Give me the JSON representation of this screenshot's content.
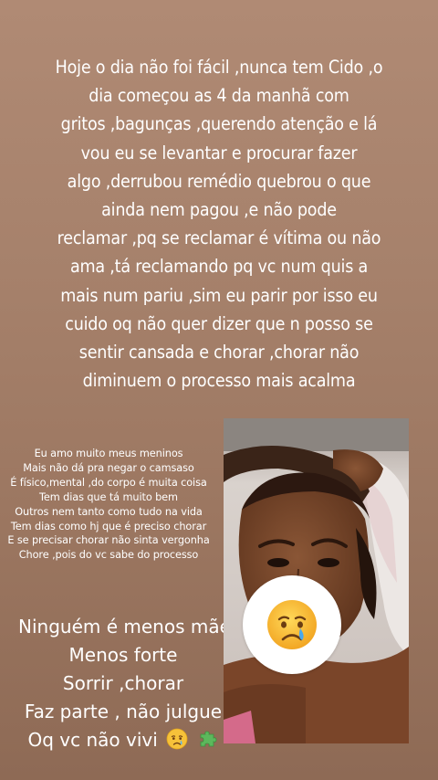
{
  "story": {
    "main_lines": [
      "Hoje o dia não foi fácil ,nunca tem Cido ,o",
      "dia começou as 4 da manhã com",
      "gritos ,bagunças ,querendo atenção e lá",
      "vou eu se levantar e procurar fazer",
      "algo ,derrubou remédio quebrou o que",
      "ainda nem pagou ,e não pode",
      "reclamar ,pq se reclamar é vítima ou não",
      "ama ,tá reclamando pq vc num quis a",
      "mais num pariu ,sim eu parir por isso eu",
      "cuido oq não quer dizer que n posso se",
      "sentir cansada e chorar ,chorar não",
      "diminuem o processo mais acalma"
    ],
    "poem_lines": [
      "Eu amo muito meus meninos",
      "Mais não dá pra negar o camsaso",
      "É físico,mental ,do corpo é muita coisa",
      "Tem dias que tá muito bem",
      "Outros nem tanto como tudo na vida",
      "Tem dias como hj que é preciso chorar",
      "E se precisar chorar não sinta vergonha",
      "Chore ,pois do vc sabe do processo"
    ],
    "big_lines": [
      "Ninguém é menos mãe",
      "Menos forte",
      "Sorrir ,chorar",
      "Faz parte , não julgue",
      "Oq vc não vivi"
    ],
    "emojis": {
      "crying_face": "crying-face-icon",
      "puzzle": "puzzle-piece-icon",
      "sticker": "crying-face-sticker"
    },
    "colors": {
      "background_top": "#b08a74",
      "background_bottom": "#8e6a55",
      "text": "#ffffff"
    }
  }
}
